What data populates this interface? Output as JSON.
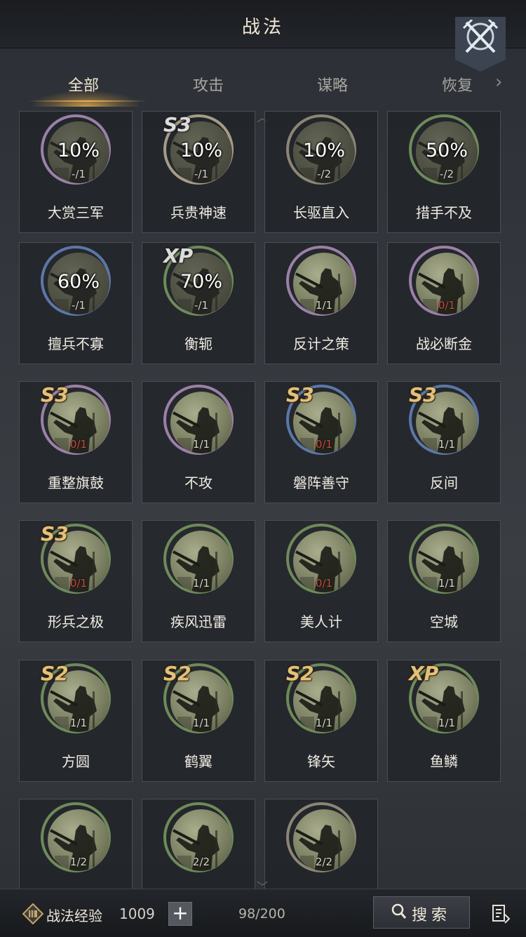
{
  "header": {
    "title": "战法"
  },
  "tabs": [
    {
      "label": "全部",
      "active": true
    },
    {
      "label": "攻击",
      "active": false
    },
    {
      "label": "谋略",
      "active": false
    },
    {
      "label": "恢复",
      "active": false
    }
  ],
  "cards": [
    {
      "name": "大赏三军",
      "ring": "purple",
      "cooldown": "10%",
      "count": "-/1",
      "badge": ""
    },
    {
      "name": "兵贵神速",
      "ring": "gold",
      "cooldown": "10%",
      "count": "-/1",
      "badge": "S3",
      "badge_style": "silver"
    },
    {
      "name": "长驱直入",
      "ring": "grey",
      "cooldown": "10%",
      "count": "-/2",
      "badge": ""
    },
    {
      "name": "措手不及",
      "ring": "green",
      "cooldown": "50%",
      "count": "-/2",
      "badge": ""
    },
    {
      "name": "擅兵不寡",
      "ring": "blue",
      "cooldown": "60%",
      "count": "-/1",
      "badge": ""
    },
    {
      "name": "衡轭",
      "ring": "green",
      "cooldown": "70%",
      "count": "-/1",
      "badge": "XP",
      "badge_style": "silver"
    },
    {
      "name": "反计之策",
      "ring": "purple",
      "cooldown": "",
      "count": "1/1",
      "badge": ""
    },
    {
      "name": "战必断金",
      "ring": "purple",
      "cooldown": "",
      "count": "0/1",
      "count_red": true,
      "badge": ""
    },
    {
      "name": "重整旗鼓",
      "ring": "purple",
      "cooldown": "",
      "count": "0/1",
      "count_red": true,
      "badge": "S3"
    },
    {
      "name": "不攻",
      "ring": "purple",
      "cooldown": "",
      "count": "1/1",
      "badge": ""
    },
    {
      "name": "磐阵善守",
      "ring": "blue",
      "cooldown": "",
      "count": "0/1",
      "count_red": true,
      "badge": "S3"
    },
    {
      "name": "反间",
      "ring": "blue",
      "cooldown": "",
      "count": "1/1",
      "badge": "S3"
    },
    {
      "name": "形兵之极",
      "ring": "green",
      "cooldown": "",
      "count": "0/1",
      "count_red": true,
      "badge": "S3"
    },
    {
      "name": "疾风迅雷",
      "ring": "green",
      "cooldown": "",
      "count": "1/1",
      "badge": ""
    },
    {
      "name": "美人计",
      "ring": "green",
      "cooldown": "",
      "count": "0/1",
      "count_red": true,
      "badge": ""
    },
    {
      "name": "空城",
      "ring": "green",
      "cooldown": "",
      "count": "1/1",
      "badge": ""
    },
    {
      "name": "方圆",
      "ring": "green",
      "cooldown": "",
      "count": "1/1",
      "badge": "S2"
    },
    {
      "name": "鹤翼",
      "ring": "green",
      "cooldown": "",
      "count": "1/1",
      "badge": "S2"
    },
    {
      "name": "锋矢",
      "ring": "green",
      "cooldown": "",
      "count": "1/1",
      "badge": "S2"
    },
    {
      "name": "鱼鳞",
      "ring": "green",
      "cooldown": "",
      "count": "1/1",
      "badge": "XP"
    },
    {
      "name": "",
      "ring": "green",
      "cooldown": "",
      "count": "1/2",
      "badge": ""
    },
    {
      "name": "",
      "ring": "green",
      "cooldown": "",
      "count": "2/2",
      "badge": ""
    },
    {
      "name": "",
      "ring": "grey",
      "cooldown": "",
      "count": "2/2",
      "badge": ""
    }
  ],
  "footer": {
    "exp_label": "战法经验",
    "exp_value": "1009",
    "plus_label": "+",
    "capacity": "98/200",
    "search_label": "搜索"
  },
  "icons": {
    "close": "crossed-swords-icon",
    "exp": "scroll-emblem-icon",
    "search": "search-icon",
    "sort": "sort-list-icon",
    "tabs_more": "chevron-right-icon"
  },
  "colors": {
    "accent": "#e7b15b",
    "count_depleted": "#c94a3f",
    "ring_purple": "#9b80a8",
    "ring_blue": "#5c77a8",
    "ring_green": "#6f8a5a",
    "ring_gold": "#a69c86",
    "ring_grey": "#8c8575"
  }
}
